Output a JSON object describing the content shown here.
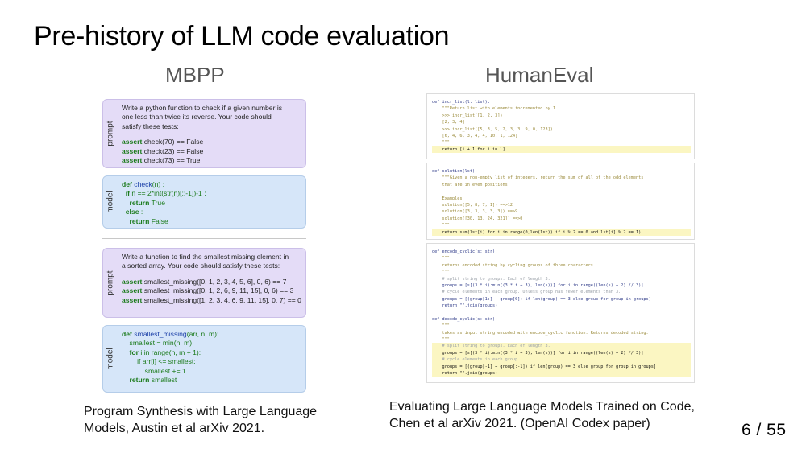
{
  "slide": {
    "title": "Pre-history of LLM code evaluation",
    "page_number": "6 / 55"
  },
  "mbpp": {
    "heading": "MBPP",
    "caption": "Program Synthesis with Large Language Models, Austin et al arXiv 2021.",
    "prompt_label": "prompt",
    "model_label": "model",
    "example1": {
      "prompt_lines": [
        "Write a python function to check if a given number is",
        "one less than twice its reverse. Your code should",
        "satisfy these tests:"
      ],
      "asserts": [
        {
          "kw": "assert",
          "text": " check(70) == False"
        },
        {
          "kw": "assert",
          "text": " check(23) == False"
        },
        {
          "kw": "assert",
          "text": " check(73) == True"
        }
      ],
      "model_lines": [
        {
          "kw": "def",
          "fn": " check",
          "text": "(n) :"
        },
        {
          "kw": "  if",
          "fn": "",
          "text": " n == 2*int(str(n)[::-1])-1 :"
        },
        {
          "kw": "    return",
          "fn": "",
          "text": " True"
        },
        {
          "kw": "  else",
          "fn": "",
          "text": " :"
        },
        {
          "kw": "    return",
          "fn": "",
          "text": " False"
        }
      ]
    },
    "example2": {
      "prompt_lines": [
        "Write a function to find the smallest missing element in",
        "a sorted array. Your code should satisfy these tests:"
      ],
      "asserts": [
        {
          "kw": "assert",
          "text": " smallest_missing([0, 1, 2, 3, 4, 5, 6], 0, 6) == 7"
        },
        {
          "kw": "assert",
          "text": " smallest_missing([0, 1, 2, 6, 9, 11, 15], 0, 6) == 3"
        },
        {
          "kw": "assert",
          "text": " smallest_missing([1, 2, 3, 4, 6, 9, 11, 15], 0, 7) == 0"
        }
      ],
      "model_lines": [
        {
          "kw": "def",
          "fn": " smallest_missing",
          "text": "(arr, n, m):"
        },
        {
          "kw": "",
          "fn": "",
          "text": "    smallest = min(n, m)"
        },
        {
          "kw": "    for",
          "fn": "",
          "text": " i in range(n, m + 1):"
        },
        {
          "kw": "",
          "fn": "",
          "text": "        if arr[i] <= smallest:"
        },
        {
          "kw": "",
          "fn": "",
          "text": "            smallest += 1"
        },
        {
          "kw": "    return",
          "fn": "",
          "text": " smallest"
        }
      ]
    }
  },
  "humaneval": {
    "heading": "HumanEval",
    "caption": "Evaluating Large Language Models Trained on Code, Chen et al arXiv 2021. (OpenAI Codex paper)",
    "snippet1": [
      {
        "t": "def incr_list(l: list):",
        "c": ""
      },
      {
        "t": "    \"\"\"Return list with elements incremented by 1.",
        "c": "doc"
      },
      {
        "t": "    >>> incr_list([1, 2, 3])",
        "c": "doc"
      },
      {
        "t": "    [2, 3, 4]",
        "c": "doc"
      },
      {
        "t": "    >>> incr_list([5, 3, 5, 2, 3, 3, 9, 0, 123])",
        "c": "doc"
      },
      {
        "t": "    [6, 4, 6, 3, 4, 4, 10, 1, 124]",
        "c": "doc"
      },
      {
        "t": "    \"\"\"",
        "c": "doc"
      },
      {
        "t": "    return [i + 1 for i in l]",
        "c": "hl"
      }
    ],
    "snippet2": [
      {
        "t": "def solution(lst):",
        "c": ""
      },
      {
        "t": "    \"\"\"Given a non-empty list of integers, return the sum of all of the odd elements",
        "c": "doc"
      },
      {
        "t": "    that are in even positions.",
        "c": "doc"
      },
      {
        "t": "",
        "c": ""
      },
      {
        "t": "    Examples",
        "c": "doc"
      },
      {
        "t": "    solution([5, 8, 7, 1]) ==>12",
        "c": "doc"
      },
      {
        "t": "    solution([3, 3, 3, 3, 3]) ==>9",
        "c": "doc"
      },
      {
        "t": "    solution([30, 13, 24, 321]) ==>0",
        "c": "doc"
      },
      {
        "t": "    \"\"\"",
        "c": "doc"
      },
      {
        "t": "    return sum(lst[i] for i in range(0,len(lst)) if i % 2 == 0 and lst[i] % 2 == 1)",
        "c": "hl"
      }
    ],
    "snippet3": [
      {
        "t": "def encode_cyclic(s: str):",
        "c": ""
      },
      {
        "t": "    \"\"\"",
        "c": "doc"
      },
      {
        "t": "    returns encoded string by cycling groups of three characters.",
        "c": "doc"
      },
      {
        "t": "    \"\"\"",
        "c": "doc"
      },
      {
        "t": "    # split string to groups. Each of length 3.",
        "c": "cm"
      },
      {
        "t": "    groups = [s[(3 * i):min((3 * i + 3), len(s))] for i in range((len(s) + 2) // 3)]",
        "c": ""
      },
      {
        "t": "    # cycle elements in each group. Unless group has fewer elements than 3.",
        "c": "cm"
      },
      {
        "t": "    groups = [(group[1:] + group[0]) if len(group) == 3 else group for group in groups]",
        "c": ""
      },
      {
        "t": "    return \"\".join(groups)",
        "c": ""
      },
      {
        "t": "",
        "c": ""
      },
      {
        "t": "def decode_cyclic(s: str):",
        "c": ""
      },
      {
        "t": "    \"\"\"",
        "c": "doc"
      },
      {
        "t": "    takes as input string encoded with encode_cyclic function. Returns decoded string.",
        "c": "doc"
      },
      {
        "t": "    \"\"\"",
        "c": "doc"
      },
      {
        "t": "    # split string to groups. Each of length 3.",
        "c": "hl cm"
      },
      {
        "t": "    groups = [s[(3 * i):min((3 * i + 3), len(s))] for i in range((len(s) + 2) // 3)]",
        "c": "hl"
      },
      {
        "t": "    # cycle elements in each group.",
        "c": "hl cm"
      },
      {
        "t": "    groups = [(group[-1] + group[:-1]) if len(group) == 3 else group for group in groups]",
        "c": "hl"
      },
      {
        "t": "    return \"\".join(groups)",
        "c": "hl"
      }
    ]
  }
}
